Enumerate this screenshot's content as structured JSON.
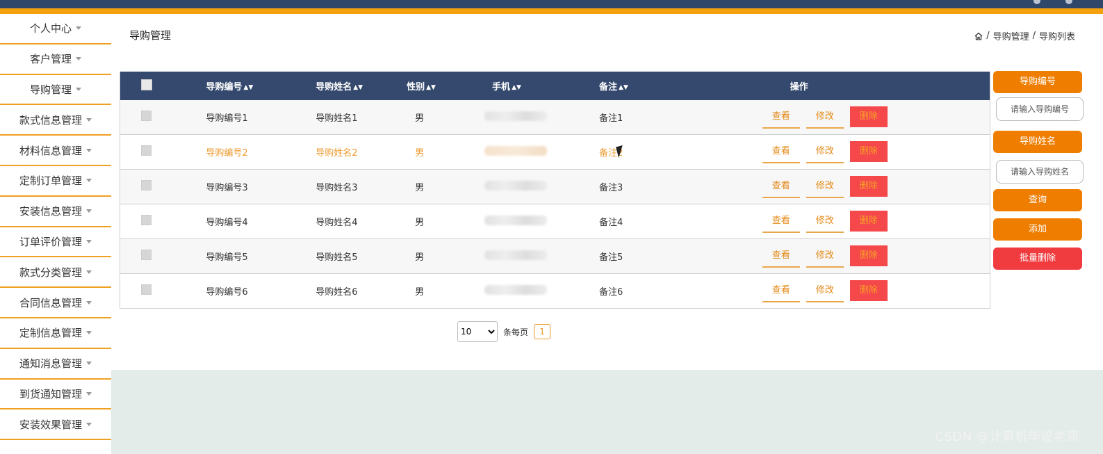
{
  "sidebar": {
    "items": [
      {
        "label": "个人中心"
      },
      {
        "label": "客户管理"
      },
      {
        "label": "导购管理"
      },
      {
        "label": "款式信息管理"
      },
      {
        "label": "材料信息管理"
      },
      {
        "label": "定制订单管理"
      },
      {
        "label": "安装信息管理"
      },
      {
        "label": "订单评价管理"
      },
      {
        "label": "款式分类管理"
      },
      {
        "label": "合同信息管理"
      },
      {
        "label": "定制信息管理"
      },
      {
        "label": "通知消息管理"
      },
      {
        "label": "到货通知管理"
      },
      {
        "label": "安装效果管理"
      }
    ]
  },
  "page": {
    "title": "导购管理"
  },
  "breadcrumb": {
    "level1": "导购管理",
    "level2": "导购列表",
    "sep": "/"
  },
  "table": {
    "headers": {
      "id": "导购编号",
      "name": "导购姓名",
      "gender": "性别",
      "phone": "手机",
      "remark": "备注",
      "ops": "操作"
    },
    "rows": [
      {
        "id": "导购编号1",
        "name": "导购姓名1",
        "gender": "男",
        "remark": "备注1"
      },
      {
        "id": "导购编号2",
        "name": "导购姓名2",
        "gender": "男",
        "remark": "备注2"
      },
      {
        "id": "导购编号3",
        "name": "导购姓名3",
        "gender": "男",
        "remark": "备注3"
      },
      {
        "id": "导购编号4",
        "name": "导购姓名4",
        "gender": "男",
        "remark": "备注4"
      },
      {
        "id": "导购编号5",
        "name": "导购姓名5",
        "gender": "男",
        "remark": "备注5"
      },
      {
        "id": "导购编号6",
        "name": "导购姓名6",
        "gender": "男",
        "remark": "备注6"
      }
    ],
    "actions": {
      "view": "查看",
      "edit": "修改",
      "delete": "删除"
    }
  },
  "pager": {
    "page_size": "10",
    "per_page_label": "条每页",
    "current_page": "1"
  },
  "search": {
    "id_label": "导购编号",
    "id_placeholder": "请输入导购编号",
    "name_label": "导购姓名",
    "name_placeholder": "请输入导购姓名",
    "query": "查询",
    "add": "添加",
    "batch_delete": "批量删除"
  },
  "watermark": "CSDN @计算机毕设老哥",
  "colors": {
    "accent": "#ef7d00",
    "header": "#34496d",
    "danger": "#f03b3f",
    "highlight_text": "#ee9a2c"
  }
}
